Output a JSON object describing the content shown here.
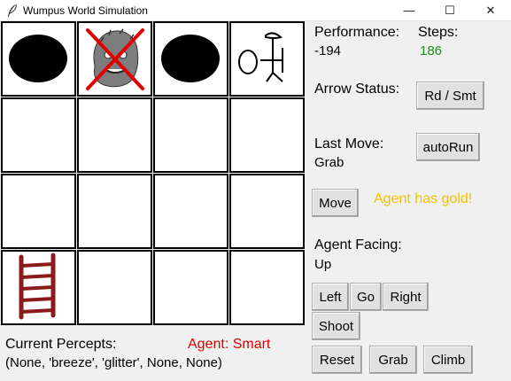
{
  "window": {
    "title": "Wumpus World Simulation",
    "minimize_glyph": "—",
    "maximize_glyph": "☐",
    "close_glyph": "✕"
  },
  "board": {
    "rows": 4,
    "cols": 4,
    "cells": [
      {
        "row": 0,
        "col": 0,
        "content": "pit-icon"
      },
      {
        "row": 0,
        "col": 1,
        "content": "dead-wumpus-icon"
      },
      {
        "row": 0,
        "col": 2,
        "content": "pit-icon"
      },
      {
        "row": 0,
        "col": 3,
        "content": "agent-with-gold-icon"
      },
      {
        "row": 3,
        "col": 0,
        "content": "ladder-icon"
      }
    ]
  },
  "status": {
    "performance_label": "Performance:",
    "performance_value": "-194",
    "steps_label": "Steps:",
    "steps_value": "186",
    "arrow_status_label": "Arrow Status:",
    "last_move_label": "Last Move:",
    "last_move_value": "Grab",
    "gold_message": "Agent has gold!",
    "facing_label": "Agent Facing:",
    "facing_value": "Up",
    "percepts_label": "Current Percepts:",
    "percepts_value": "(None, 'breeze', 'glitter', None, None)",
    "agent_label": "Agent:  Smart"
  },
  "buttons": {
    "rd_smt": "Rd / Smt",
    "autorun": "autoRun",
    "move": "Move",
    "left": "Left",
    "go": "Go",
    "right": "Right",
    "shoot": "Shoot",
    "reset": "Reset",
    "grab": "Grab",
    "climb": "Climb"
  },
  "colors": {
    "steps": "#1a8f1a",
    "gold_message": "#f2c200",
    "agent_label": "#e00000",
    "ladder": "#8b1a1a",
    "cross": "#e00000"
  }
}
